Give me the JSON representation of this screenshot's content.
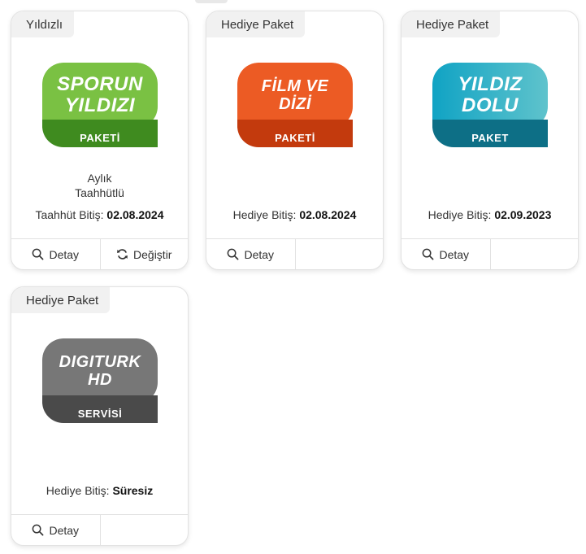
{
  "cards": [
    {
      "tag": "Yıldızlı",
      "logo": {
        "line1": "SPORUN",
        "line2": "YILDIZI",
        "sub": "PAKETİ",
        "color_top": "#7ac143",
        "color_bottom": "#3f8b1f"
      },
      "commit_line1": "Aylık",
      "commit_line2": "Taahhütlü",
      "end_label": "Taahhüt Bitiş: ",
      "end_value": "02.08.2024",
      "detail_label": "Detay",
      "change_label": "Değiştir"
    },
    {
      "tag": "Hediye Paket",
      "logo": {
        "line1": "FİLM VE",
        "line2": "DİZİ",
        "sub": "PAKETİ",
        "color_top": "#ec5b24",
        "color_bottom": "#c33a0d"
      },
      "end_label": "Hediye Bitiş: ",
      "end_value": "02.08.2024",
      "detail_label": "Detay"
    },
    {
      "tag": "Hediye Paket",
      "logo": {
        "line1": "YILDIZ",
        "line2": "DOLU",
        "sub": "PAKET",
        "color_top": "#10a3c4",
        "color_bottom": "#0d6f86"
      },
      "end_label": "Hediye Bitiş: ",
      "end_value": "02.09.2023",
      "detail_label": "Detay"
    },
    {
      "tag": "Hediye Paket",
      "logo": {
        "line1": "DIGITURK",
        "line2": "HD",
        "sub": "SERVİSİ",
        "color_top": "#777777",
        "color_bottom": "#4a4a4a"
      },
      "end_label": "Hediye Bitiş: ",
      "end_value": "Süresiz",
      "detail_label": "Detay"
    }
  ],
  "icons": {
    "detail": "search-icon",
    "change": "refresh-icon"
  }
}
